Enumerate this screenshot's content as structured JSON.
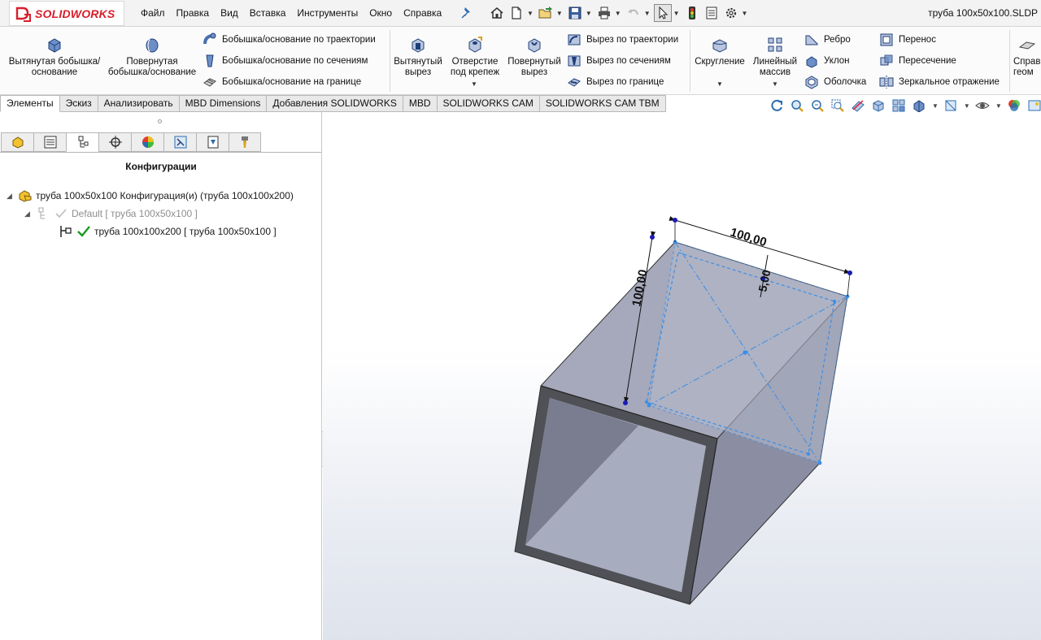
{
  "app": {
    "logo_text": "SOLIDWORKS",
    "document_title": "труба 100x50x100.SLDP"
  },
  "menu": {
    "items": [
      "Файл",
      "Правка",
      "Вид",
      "Вставка",
      "Инструменты",
      "Окно",
      "Справка"
    ]
  },
  "commands": {
    "extruded_boss": "Вытянутая бобышка/основание",
    "revolved_boss": "Повернутая бобышка/основание",
    "swept_boss": "Бобышка/основание по траектории",
    "lofted_boss": "Бобышка/основание по сечениям",
    "boundary_boss": "Бобышка/основание на границе",
    "extruded_cut": "Вытянутый вырез",
    "hole_wizard": "Отверстие под крепеж",
    "revolved_cut": "Повернутый вырез",
    "swept_cut": "Вырез по траектории",
    "lofted_cut": "Вырез по сечениям",
    "boundary_cut": "Вырез по границе",
    "fillet": "Скругление",
    "linear_pattern": "Линейный массив",
    "rib": "Ребро",
    "draft": "Уклон",
    "shell": "Оболочка",
    "wrap": "Перенос",
    "intersect": "Пересечение",
    "mirror": "Зеркальное отражение",
    "reference_geometry": "Справ геом"
  },
  "tabs": [
    "Элементы",
    "Эскиз",
    "Анализировать",
    "MBD Dimensions",
    "Добавления SOLIDWORKS",
    "MBD",
    "SOLIDWORKS CAM",
    "SOLIDWORKS CAM TBM"
  ],
  "active_tab": "Элементы",
  "panel": {
    "title": "Конфигурации",
    "tree": {
      "root": "труба 100x50x100 Конфигурация(и)  (труба 100x100x200)",
      "default_config": "Default [ труба 100x50x100 ]",
      "active_config": "труба 100x100x200 [ труба 100x50x100 ]"
    }
  },
  "viewport": {
    "dim_width": "100,00",
    "dim_height": "100,00",
    "dim_wall": "5,00"
  },
  "colors": {
    "brand_red": "#d81e2c",
    "sketch_blue": "#3a8ee6",
    "part_face": "#9ea2b3",
    "check_green": "#1a9a1a"
  }
}
